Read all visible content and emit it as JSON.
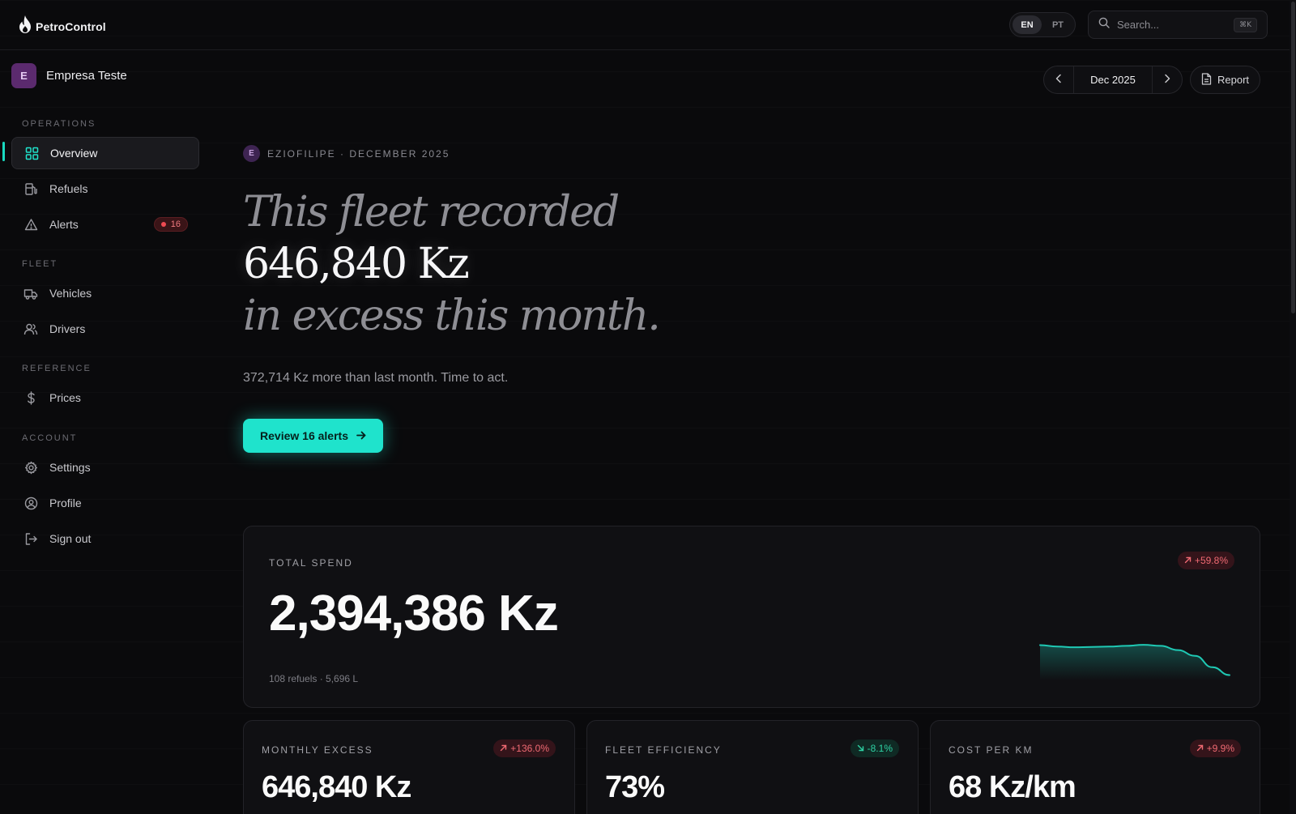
{
  "brand": {
    "name": "PetroControl"
  },
  "language": {
    "options": [
      "EN",
      "PT"
    ],
    "selected": "EN"
  },
  "search": {
    "placeholder": "Search...",
    "shortcut": "⌘K"
  },
  "company": {
    "initial": "E",
    "name": "Empresa Teste"
  },
  "sidebar": {
    "sections": [
      {
        "label": "OPERATIONS",
        "items": [
          {
            "label": "Overview",
            "icon": "grid-icon",
            "active": true
          },
          {
            "label": "Refuels",
            "icon": "fuel-pump-icon"
          },
          {
            "label": "Alerts",
            "icon": "warning-triangle-icon",
            "badge": "16"
          }
        ]
      },
      {
        "label": "FLEET",
        "items": [
          {
            "label": "Vehicles",
            "icon": "truck-icon"
          },
          {
            "label": "Drivers",
            "icon": "users-icon"
          }
        ]
      },
      {
        "label": "REFERENCE",
        "items": [
          {
            "label": "Prices",
            "icon": "dollar-icon"
          }
        ]
      },
      {
        "label": "ACCOUNT",
        "items": [
          {
            "label": "Settings",
            "icon": "gear-icon"
          },
          {
            "label": "Profile",
            "icon": "user-circle-icon"
          },
          {
            "label": "Sign out",
            "icon": "sign-out-icon"
          }
        ]
      }
    ]
  },
  "period": {
    "label": "Dec 2025"
  },
  "report": {
    "label": "Report"
  },
  "hero": {
    "avatar_initial": "E",
    "eyebrow": "EZIOFILIPE · DECEMBER 2025",
    "line1": "This fleet recorded",
    "line2": "646,840 Kz",
    "line3": "in excess this month.",
    "subtitle": "372,714 Kz more than last month. Time to act.",
    "cta_label": "Review 16 alerts"
  },
  "total_spend": {
    "label": "TOTAL SPEND",
    "value": "2,394,386 Kz",
    "delta": "+59.8%",
    "sub": "108 refuels · 5,696 L",
    "trend": [
      0.92,
      0.88,
      0.86,
      0.87,
      0.88,
      0.9,
      0.93,
      0.9,
      0.78,
      0.62,
      0.3,
      0.08
    ]
  },
  "kpis": [
    {
      "label": "MONTHLY EXCESS",
      "value": "646,840 Kz",
      "delta": "+136.0%",
      "direction": "up",
      "tone": "red"
    },
    {
      "label": "FLEET EFFICIENCY",
      "value": "73%",
      "delta": "-8.1%",
      "direction": "down",
      "tone": "green"
    },
    {
      "label": "COST PER KM",
      "value": "68 Kz/km",
      "delta": "+9.9%",
      "direction": "up",
      "tone": "red"
    }
  ],
  "colors": {
    "accent": "#1fe3cc",
    "danger": "#ef4a52",
    "success": "#2ed3a5",
    "background": "#0a0a0c"
  }
}
